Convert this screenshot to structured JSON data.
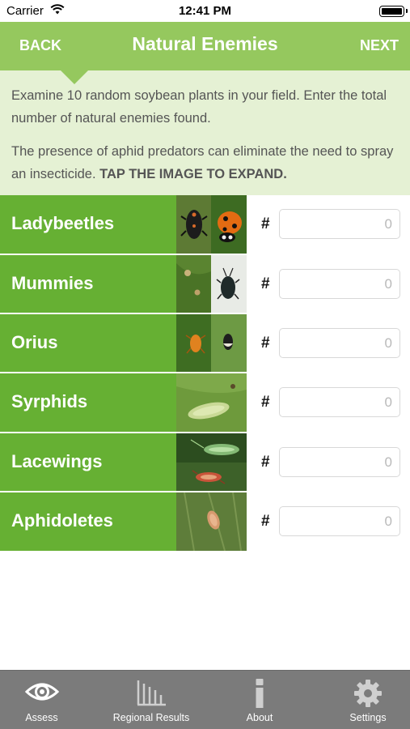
{
  "status_bar": {
    "carrier": "Carrier",
    "time": "12:41 PM"
  },
  "nav": {
    "back_label": "BACK",
    "title": "Natural Enemies",
    "next_label": "NEXT",
    "color": "#95c85e"
  },
  "intro": {
    "paragraph1": "Examine 10 random soybean plants in your field. Enter the total number of natural enemies found.",
    "paragraph2": "The presence of aphid predators can eliminate the need to spray an insecticide.",
    "paragraph2_emphasis": "TAP THE IMAGE TO EXPAND.",
    "background": "#e5f1d4"
  },
  "enemies": {
    "accent_color": "#66b033",
    "hash_symbol": "#",
    "items": [
      {
        "label": "Ladybeetles",
        "count_placeholder": "0",
        "count_value": ""
      },
      {
        "label": "Mummies",
        "count_placeholder": "0",
        "count_value": ""
      },
      {
        "label": "Orius",
        "count_placeholder": "0",
        "count_value": ""
      },
      {
        "label": "Syrphids",
        "count_placeholder": "0",
        "count_value": ""
      },
      {
        "label": "Lacewings",
        "count_placeholder": "0",
        "count_value": ""
      },
      {
        "label": "Aphidoletes",
        "count_placeholder": "0",
        "count_value": ""
      }
    ]
  },
  "tab_bar": {
    "background": "#7b7b7b",
    "selected_tab": "Assess",
    "tabs": [
      {
        "label": "Assess",
        "icon": "eye-icon"
      },
      {
        "label": "Regional Results",
        "icon": "bar-chart-icon"
      },
      {
        "label": "About",
        "icon": "info-icon"
      },
      {
        "label": "Settings",
        "icon": "gear-icon"
      }
    ]
  }
}
